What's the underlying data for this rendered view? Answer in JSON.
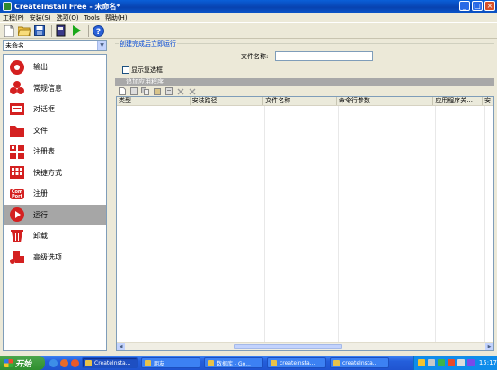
{
  "window": {
    "title": "CreateInstall Free - 未命名*"
  },
  "menu": [
    "工程(P)",
    "安装(S)",
    "选项(O)",
    "Tools",
    "帮助(H)"
  ],
  "project": {
    "selected": "未命名"
  },
  "nav": [
    {
      "label": "输出",
      "icon": "output-icon",
      "color": "#d42020"
    },
    {
      "label": "常规信息",
      "icon": "general-info-icon",
      "color": "#d42020"
    },
    {
      "label": "对话框",
      "icon": "dialog-icon",
      "color": "#d42020"
    },
    {
      "label": "文件",
      "icon": "folder-icon",
      "color": "#d42020"
    },
    {
      "label": "注册表",
      "icon": "registry-icon",
      "color": "#d42020"
    },
    {
      "label": "快捷方式",
      "icon": "shortcut-icon",
      "color": "#d42020"
    },
    {
      "label": "注册",
      "icon": "com-register-icon",
      "color": "#d42020"
    },
    {
      "label": "运行",
      "icon": "run-icon",
      "color": "#d42020",
      "active": true
    },
    {
      "label": "卸载",
      "icon": "uninstall-icon",
      "color": "#d42020"
    },
    {
      "label": "高级选项",
      "icon": "advanced-options-icon",
      "color": "#d42020"
    }
  ],
  "run_after": {
    "group_title": "创建完成后立即运行",
    "filename_label": "文件名称:",
    "filename_value": "",
    "checkbox_label": "显示复选框",
    "checkbox_checked": false
  },
  "apps": {
    "section_title": "追加应用程序",
    "columns": [
      "类型",
      "安装路径",
      "文件名称",
      "命令行参数",
      "应用程序关...",
      "安"
    ]
  },
  "taskbar": {
    "start_label": "开始",
    "tasks": [
      "CreateInsta...",
      "朋友",
      "数据库 - Go...",
      "createinsta...",
      "createInsta..."
    ],
    "clock": "15:17"
  }
}
